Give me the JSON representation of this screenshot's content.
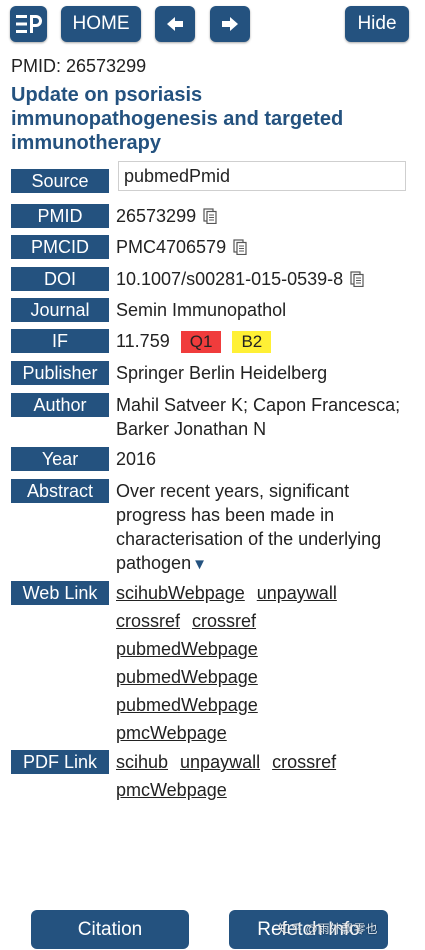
{
  "toolbar": {
    "home_label": "HOME",
    "hide_label": "Hide"
  },
  "pmid_header": "PMID: 26573299",
  "title": "Update on psoriasis immunopathogenesis and targeted immunotherapy",
  "fields": {
    "source": {
      "label": "Source",
      "value": "pubmedPmid"
    },
    "pmid": {
      "label": "PMID",
      "value": "26573299"
    },
    "pmcid": {
      "label": "PMCID",
      "value": "PMC4706579"
    },
    "doi": {
      "label": "DOI",
      "value": "10.1007/s00281-015-0539-8"
    },
    "journal": {
      "label": "Journal",
      "value": "Semin Immunopathol"
    },
    "if": {
      "label": "IF",
      "value": "11.759",
      "quartile": "Q1",
      "grade": "B2"
    },
    "publisher": {
      "label": "Publisher",
      "value": "Springer Berlin Heidelberg"
    },
    "author": {
      "label": "Author",
      "value": "Mahil Satveer K; Capon Francesca; Barker Jonathan N"
    },
    "year": {
      "label": "Year",
      "value": "2016"
    },
    "abstract": {
      "label": "Abstract",
      "value": "Over recent years, significant progress has been made in characterisation of the underlying pathogen",
      "expand_glyph": "▼"
    }
  },
  "web_link": {
    "label": "Web Link",
    "links": [
      "scihubWebpage",
      "unpaywall",
      "crossref",
      "crossref",
      "pubmedWebpage",
      "pubmedWebpage",
      "pubmedWebpage",
      "pmcWebpage"
    ]
  },
  "pdf_link": {
    "label": "PDF Link",
    "links": [
      "scihub",
      "unpaywall",
      "crossref",
      "pmcWebpage"
    ]
  },
  "bottom": {
    "citation_label": "Citation",
    "refetch_label": "Refetch Info"
  },
  "watermark": "知乎 @雨外飘零也"
}
